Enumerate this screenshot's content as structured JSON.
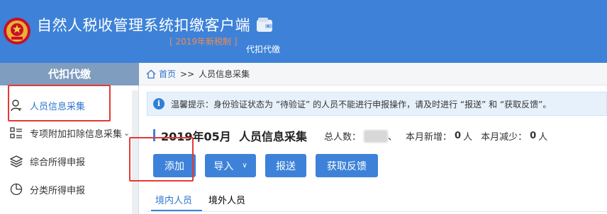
{
  "header": {
    "app_title": "自然人税收管理系统扣缴客户端",
    "app_subtitle": "[ 2019年新税制 ]",
    "module_label": "代扣代缴"
  },
  "sidebar": {
    "title": "代扣代缴",
    "items": [
      {
        "label": "人员信息采集",
        "icon": "person-icon",
        "active": true
      },
      {
        "label": "专项附加扣除信息采集",
        "icon": "list-icon",
        "has_submenu": true,
        "chevron": "⌄"
      },
      {
        "label": "综合所得申报",
        "icon": "layers-icon"
      },
      {
        "label": "分类所得申报",
        "icon": "pie-clock-icon"
      }
    ]
  },
  "breadcrumb": {
    "home": "首页",
    "separator": ">>",
    "current": "人员信息采集"
  },
  "notice": {
    "icon": "i",
    "text": "温馨提示：身份验证状态为 “待验证” 的人员不能进行申报操作，请及时进行 “报送” 和 “获取反馈”。"
  },
  "summary": {
    "period": "2019年05月",
    "section": "人员信息采集",
    "total_label": "总人数：",
    "total_suffix": "、",
    "new_label": "本月新增：",
    "new_value": "0",
    "new_unit": "人",
    "reduce_label": "本月减少：",
    "reduce_value": "0",
    "reduce_unit": "人"
  },
  "toolbar": {
    "add": "添加",
    "import": "导入",
    "import_caret": "∨",
    "submit": "报送",
    "feedback": "获取反馈"
  },
  "tabs": [
    {
      "label": "境内人员",
      "active": true
    },
    {
      "label": "境外人员",
      "active": false
    }
  ],
  "colors": {
    "header_bg": "#3d82d8",
    "accent": "#2f74d0",
    "subtitle": "#f08a52",
    "annotation": "#e53935"
  }
}
